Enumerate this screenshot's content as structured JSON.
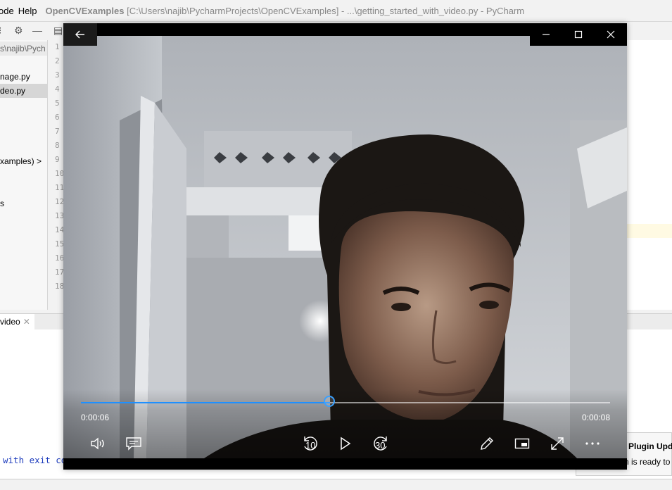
{
  "ide": {
    "menu": [
      "ode",
      "Help"
    ],
    "title_bold": "OpenCVExamples",
    "title_rest": "[C:\\Users\\najib\\PycharmProjects\\OpenCVExamples] - ...\\getting_started_with_video.py - PyCharm",
    "sidebar": {
      "path": "s\\najib\\Pych",
      "file1": "nage.py",
      "file2": "deo.py",
      "project": "xamples) >",
      "item": "s"
    },
    "line_numbers": [
      "1",
      "2",
      "3",
      "4",
      "5",
      "6",
      "7",
      "8",
      "9",
      "10",
      "11",
      "12",
      "13",
      "14",
      "15",
      "16",
      "17",
      "18"
    ],
    "run_tab": "video",
    "console_line": " with exit co",
    "notification": {
      "title": "Plugin Upda",
      "body": "n is ready to"
    }
  },
  "player": {
    "current_time": "0:00:06",
    "total_time": "0:00:08",
    "progress_fraction": 0.471,
    "skip_back_label": "10",
    "skip_forward_label": "30",
    "accent_color": "#1e90ff",
    "icons": [
      "back-arrow-icon",
      "minimize-icon",
      "maximize-icon",
      "close-icon",
      "volume-icon",
      "subtitles-icon",
      "skip-back-icon",
      "play-icon",
      "skip-forward-icon",
      "pen-icon",
      "mini-view-icon",
      "fullscreen-icon",
      "more-icon"
    ]
  }
}
